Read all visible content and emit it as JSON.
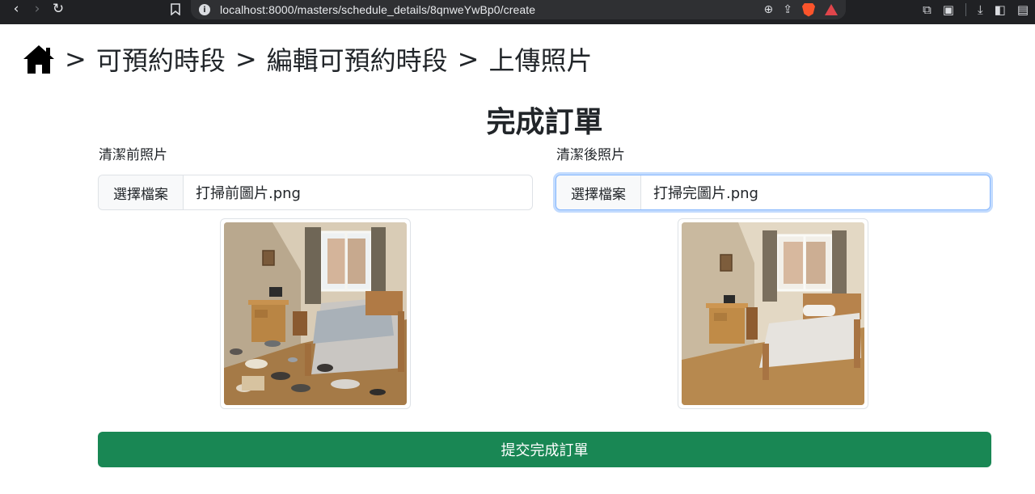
{
  "browser": {
    "url": "localhost:8000/masters/schedule_details/8qnweYwBp0/create"
  },
  "breadcrumb": {
    "separator": ">",
    "items": [
      "可預約時段",
      "編輯可預約時段",
      "上傳照片"
    ]
  },
  "title": "完成訂單",
  "before": {
    "label": "清潔前照片",
    "button": "選擇檔案",
    "filename": "打掃前圖片.png"
  },
  "after": {
    "label": "清潔後照片",
    "button": "選擇檔案",
    "filename": "打掃完圖片.png"
  },
  "submit_label": "提交完成訂單",
  "colors": {
    "accent_green": "#198754",
    "focus_blue": "#86b7fe"
  }
}
